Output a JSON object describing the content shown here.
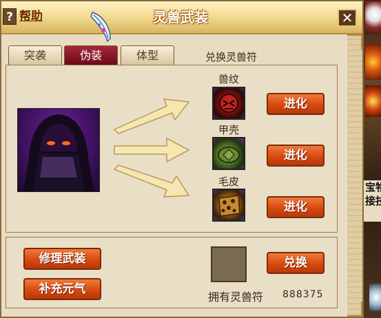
{
  "window": {
    "title": "灵兽武装",
    "help_label": "帮助",
    "help_icon": "?",
    "close_label": "✕"
  },
  "tabs": [
    {
      "label": "突袭",
      "active": false
    },
    {
      "label": "伪装",
      "active": true
    },
    {
      "label": "体型",
      "active": false
    }
  ],
  "exchange_title": "兑换灵兽符",
  "slots": [
    {
      "label": "兽纹",
      "button": "进化"
    },
    {
      "label": "甲壳",
      "button": "进化"
    },
    {
      "label": "毛皮",
      "button": "进化"
    }
  ],
  "bottom": {
    "repair_label": "修理武装",
    "replenish_label": "补充元气",
    "exchange_button": "兑换",
    "holding_label": "拥有灵兽符",
    "holding_count": "888375"
  },
  "backdrop": {
    "text": "宝物\n接技"
  },
  "colors": {
    "accent_button": "#d84a10",
    "active_tab": "#8a1828",
    "panel_bg": "#e8ddc3"
  }
}
